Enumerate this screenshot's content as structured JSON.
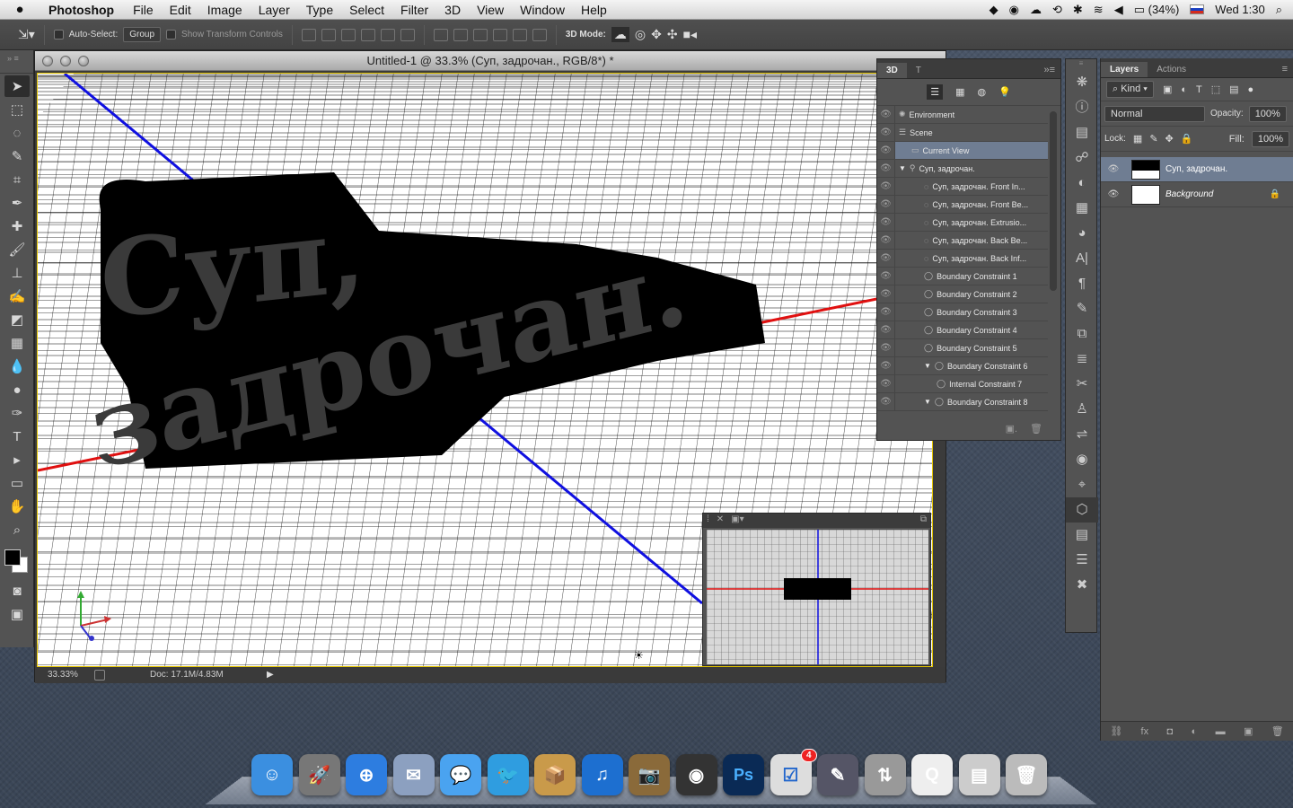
{
  "menubar": {
    "app": "Photoshop",
    "items": [
      "File",
      "Edit",
      "Image",
      "Layer",
      "Type",
      "Select",
      "Filter",
      "3D",
      "View",
      "Window",
      "Help"
    ],
    "battery": "(34%)",
    "clock": "Wed 1:30"
  },
  "options": {
    "auto_select": "Auto-Select:",
    "group": "Group",
    "show_transform": "Show Transform Controls",
    "mode3d": "3D Mode:"
  },
  "document": {
    "title": "Untitled-1 @ 33.3% (Суп, задрочан., RGB/8*) *",
    "zoom": "33.33%",
    "doc_size": "Doc: 17.1M/4.83M",
    "text_line1": "Суп,",
    "text_line2": "задрочан."
  },
  "panel3d": {
    "tabs": [
      "3D",
      "T"
    ],
    "rows": [
      {
        "label": "Environment",
        "indent": 0,
        "icon": "environment-icon"
      },
      {
        "label": "Scene",
        "indent": 0,
        "icon": "scene-icon"
      },
      {
        "label": "Current View",
        "indent": 1,
        "icon": "camera-icon",
        "selected": true
      },
      {
        "label": "Суп, задрочан.",
        "indent": 0,
        "icon": "mesh-icon",
        "expanded": true
      },
      {
        "label": "Суп, задрочан. Front In...",
        "indent": 2,
        "icon": "material-icon"
      },
      {
        "label": "Суп, задрочан. Front Be...",
        "indent": 2,
        "icon": "material-icon"
      },
      {
        "label": "Суп, задрочан. Extrusio...",
        "indent": 2,
        "icon": "material-icon"
      },
      {
        "label": "Суп, задрочан. Back Be...",
        "indent": 2,
        "icon": "material-icon"
      },
      {
        "label": "Суп, задрочан. Back Inf...",
        "indent": 2,
        "icon": "material-icon"
      },
      {
        "label": "Boundary Constraint 1",
        "indent": 2,
        "icon": "constraint-icon"
      },
      {
        "label": "Boundary Constraint 2",
        "indent": 2,
        "icon": "constraint-icon"
      },
      {
        "label": "Boundary Constraint 3",
        "indent": 2,
        "icon": "constraint-icon"
      },
      {
        "label": "Boundary Constraint 4",
        "indent": 2,
        "icon": "constraint-icon"
      },
      {
        "label": "Boundary Constraint 5",
        "indent": 2,
        "icon": "constraint-icon"
      },
      {
        "label": "Boundary Constraint 6",
        "indent": 2,
        "icon": "constraint-icon",
        "expanded": true
      },
      {
        "label": "Internal Constraint 7",
        "indent": 3,
        "icon": "constraint-icon"
      },
      {
        "label": "Boundary Constraint 8",
        "indent": 2,
        "icon": "constraint-icon",
        "expanded": true
      }
    ]
  },
  "layers": {
    "tabs": [
      "Layers",
      "Actions"
    ],
    "kind": "Kind",
    "blend": "Normal",
    "opacity_label": "Opacity:",
    "opacity": "100%",
    "lock_label": "Lock:",
    "fill_label": "Fill:",
    "fill": "100%",
    "items": [
      {
        "name": "Суп, задрочан.",
        "selected": true
      },
      {
        "name": "Background",
        "locked": true
      }
    ]
  },
  "dock": {
    "badge": "4",
    "apps": [
      {
        "name": "finder-icon",
        "color": "#3b8fe0",
        "glyph": "☺"
      },
      {
        "name": "launchpad-icon",
        "color": "#777",
        "glyph": "🚀"
      },
      {
        "name": "safari-icon",
        "color": "#2d7de0",
        "glyph": "⊕"
      },
      {
        "name": "mail-icon",
        "color": "#8ca0c0",
        "glyph": "✉"
      },
      {
        "name": "messages-icon",
        "color": "#4aa3f0",
        "glyph": "💬"
      },
      {
        "name": "twitter-icon",
        "color": "#2f9de0",
        "glyph": "🐦"
      },
      {
        "name": "archive-icon",
        "color": "#c99a4a",
        "glyph": "📦"
      },
      {
        "name": "itunes-icon",
        "color": "#1d6fd0",
        "glyph": "♫"
      },
      {
        "name": "iphoto-icon",
        "color": "#8a6a3a",
        "glyph": "📷"
      },
      {
        "name": "facetime-icon",
        "color": "#333",
        "glyph": "◉"
      },
      {
        "name": "photoshop-icon",
        "color": "#0a2a55",
        "glyph": "Ps"
      },
      {
        "name": "tasks-icon",
        "color": "#ddd",
        "glyph": "☑"
      },
      {
        "name": "instruments-icon",
        "color": "#556",
        "glyph": "✎"
      },
      {
        "name": "transmit-icon",
        "color": "#999",
        "glyph": "⇅"
      },
      {
        "name": "quicktime-doc-icon",
        "color": "#eee",
        "glyph": "Q"
      },
      {
        "name": "downloads-stack-icon",
        "color": "#ccc",
        "glyph": "▤"
      },
      {
        "name": "trash-icon",
        "color": "#bbb",
        "glyph": "🗑"
      }
    ]
  }
}
